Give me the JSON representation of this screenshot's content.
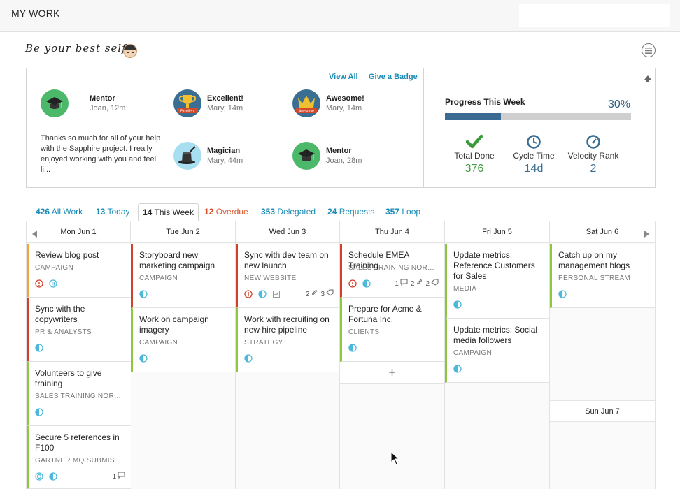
{
  "header": {
    "title": "MY WORK"
  },
  "tagline": "Be your best self.",
  "badges": {
    "view_all": "View All",
    "give_badge": "Give a Badge",
    "items": [
      {
        "name": "Mentor",
        "meta": "Joan, 12m",
        "color": "#4cb86a",
        "icon": "graduation-cap-icon"
      },
      {
        "name": "Excellent!",
        "meta": "Mary, 14m",
        "color": "#3a6e93",
        "icon": "trophy-icon",
        "ribbon": "Excellent"
      },
      {
        "name": "Awesome!",
        "meta": "Mary, 14m",
        "color": "#3a6e93",
        "icon": "crown-icon",
        "ribbon": "Awesome"
      },
      {
        "name": "Magician",
        "meta": "Mary, 44m",
        "color": "#a8dff0",
        "icon": "magic-hat-icon"
      },
      {
        "name": "Mentor",
        "meta": "Joan, 28m",
        "color": "#4cb86a",
        "icon": "graduation-cap-icon"
      }
    ],
    "quote": "Thanks so much for all of your help with the Sapphire project. I really enjoyed working with you and feel li..."
  },
  "progress": {
    "title": "Progress This Week",
    "percent_label": "30%",
    "percent": 0.3,
    "stats": [
      {
        "label": "Total Done",
        "value": "376",
        "color": "#3a9a3a",
        "icon": "checkmark-icon"
      },
      {
        "label": "Cycle Time",
        "value": "14d",
        "color": "#3a6e93",
        "icon": "clock-icon"
      },
      {
        "label": "Velocity Rank",
        "value": "2",
        "color": "#3a6e93",
        "icon": "speedometer-icon"
      }
    ]
  },
  "tabs": [
    {
      "count": "426",
      "label": "All Work"
    },
    {
      "count": "13",
      "label": "Today"
    },
    {
      "count": "14",
      "label": "This Week",
      "active": true
    },
    {
      "count": "12",
      "label": "Overdue",
      "overdue": true
    },
    {
      "count": "353",
      "label": "Delegated"
    },
    {
      "count": "24",
      "label": "Requests"
    },
    {
      "count": "357",
      "label": "Loop"
    }
  ],
  "columns": [
    {
      "head": "Mon Jun 1",
      "cards": [
        {
          "title": "Review blog post",
          "project": "CAMPAIGN",
          "color": "orange",
          "icons": [
            "alert-icon",
            "pause-icon"
          ]
        },
        {
          "title": "Sync with the copywriters",
          "project": "PR & ANALYSTS",
          "color": "red",
          "icons": [
            "half-circle-icon"
          ]
        },
        {
          "title": "Volunteers to give training",
          "project": "SALES TRAINING NORTH ...",
          "color": "green",
          "icons": [
            "half-circle-icon"
          ]
        },
        {
          "title": "Secure 5 references in F100",
          "project": "GARTNER MQ SUBMISSTI...",
          "color": "green",
          "icons": [
            "target-icon",
            "half-circle-icon"
          ],
          "comments": "1"
        }
      ]
    },
    {
      "head": "Tue Jun 2",
      "cards": [
        {
          "title": "Storyboard new marketing campaign",
          "project": "CAMPAIGN",
          "color": "red",
          "icons": [
            "half-circle-icon"
          ]
        },
        {
          "title": "Work on campaign imagery",
          "project": "CAMPAIGN",
          "color": "green",
          "icons": [
            "half-circle-icon"
          ]
        }
      ]
    },
    {
      "head": "Wed Jun 3",
      "cards": [
        {
          "title": "Sync with dev team on new launch",
          "project": "NEW WEBSITE",
          "color": "red",
          "icons": [
            "alert-icon",
            "half-circle-icon",
            "checkbox-icon"
          ],
          "attachments": "2",
          "tags": "3"
        },
        {
          "title": "Work with recruiting on new hire pipeline",
          "project": "STRATEGY",
          "color": "green",
          "icons": [
            "half-circle-icon"
          ]
        }
      ]
    },
    {
      "head": "Thu Jun 4",
      "cards": [
        {
          "title": "Schedule EMEA Training",
          "project": "SALES TRAINING NORTH ...",
          "color": "red",
          "icons": [
            "alert-icon",
            "half-circle-icon"
          ],
          "comments": "1",
          "attachments": "2",
          "tags": "2"
        },
        {
          "title": "Prepare for Acme & Fortuna Inc.",
          "project": "CLIENTS",
          "color": "green",
          "icons": [
            "half-circle-icon"
          ]
        }
      ],
      "add": "+"
    },
    {
      "head": "Fri Jun 5",
      "cards": [
        {
          "title": "Update metrics: Reference Customers for Sales",
          "project": "MEDIA",
          "color": "green",
          "icons": [
            "half-circle-icon"
          ]
        },
        {
          "title": "Update metrics: Social media followers",
          "project": "CAMPAIGN",
          "color": "green",
          "icons": [
            "half-circle-icon"
          ]
        }
      ]
    },
    {
      "head": "Sat Jun 6",
      "cards": [
        {
          "title": "Catch up on my management blogs",
          "project": "PERSONAL STREAM",
          "color": "green",
          "icons": [
            "half-circle-icon"
          ]
        }
      ],
      "sub_head": "Sun Jun 7"
    }
  ]
}
